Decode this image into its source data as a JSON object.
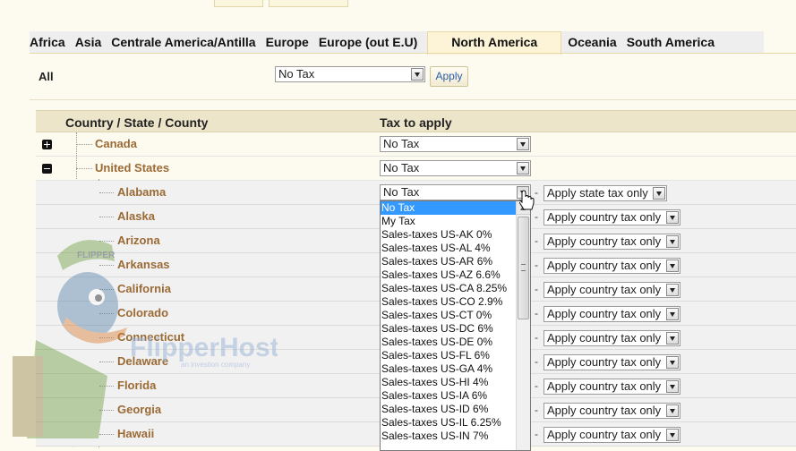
{
  "tabs": [
    {
      "label": "Africa",
      "active": false
    },
    {
      "label": "Asia",
      "active": false
    },
    {
      "label": "Centrale America/Antilla",
      "active": false
    },
    {
      "label": "Europe",
      "active": false
    },
    {
      "label": "Europe (out E.U)",
      "active": false
    },
    {
      "label": "North America",
      "active": true
    },
    {
      "label": "Oceania",
      "active": false
    },
    {
      "label": "South America",
      "active": false
    }
  ],
  "all_row": {
    "label": "All",
    "selected": "No Tax",
    "apply_label": "Apply"
  },
  "table": {
    "col_location": "Country / State / County",
    "col_tax": "Tax to apply"
  },
  "countries": [
    {
      "name": "Canada",
      "tax": "No Tax",
      "expanded": false
    },
    {
      "name": "United States",
      "tax": "No Tax",
      "expanded": true
    }
  ],
  "states": [
    {
      "name": "Alabama",
      "tax": "No Tax",
      "mode": "Apply state tax only"
    },
    {
      "name": "Alaska",
      "tax": "",
      "mode": "Apply country tax only"
    },
    {
      "name": "Arizona",
      "tax": "",
      "mode": "Apply country tax only"
    },
    {
      "name": "Arkansas",
      "tax": "",
      "mode": "Apply country tax only"
    },
    {
      "name": "California",
      "tax": "",
      "mode": "Apply country tax only"
    },
    {
      "name": "Colorado",
      "tax": "",
      "mode": "Apply country tax only"
    },
    {
      "name": "Connecticut",
      "tax": "",
      "mode": "Apply country tax only"
    },
    {
      "name": "Delaware",
      "tax": "",
      "mode": "Apply country tax only"
    },
    {
      "name": "Florida",
      "tax": "",
      "mode": "Apply country tax only"
    },
    {
      "name": "Georgia",
      "tax": "",
      "mode": "Apply country tax only"
    },
    {
      "name": "Hawaii",
      "tax": "",
      "mode": "Apply country tax only"
    }
  ],
  "dropdown_options": [
    "No Tax",
    "My Tax",
    "Sales-taxes US-AK 0%",
    "Sales-taxes US-AL 4%",
    "Sales-taxes US-AR 6%",
    "Sales-taxes US-AZ 6.6%",
    "Sales-taxes US-CA 8.25%",
    "Sales-taxes US-CO 2.9%",
    "Sales-taxes US-CT 0%",
    "Sales-taxes US-DC 6%",
    "Sales-taxes US-DE 0%",
    "Sales-taxes US-FL 6%",
    "Sales-taxes US-GA 4%",
    "Sales-taxes US-HI 4%",
    "Sales-taxes US-IA 6%",
    "Sales-taxes US-ID 6%",
    "Sales-taxes US-IL 6.25%",
    "Sales-taxes US-IN 7%"
  ],
  "dropdown_selected_index": 0,
  "watermark": {
    "brand": "FlipperHost",
    "tagline": "an investion company",
    "cap_text": "FLIPPER"
  },
  "colors": {
    "tree_label": "#9b6a35",
    "selection": "#3399ff",
    "header_bg": "#ede5ca",
    "page_bg": "#fdfbf0"
  }
}
